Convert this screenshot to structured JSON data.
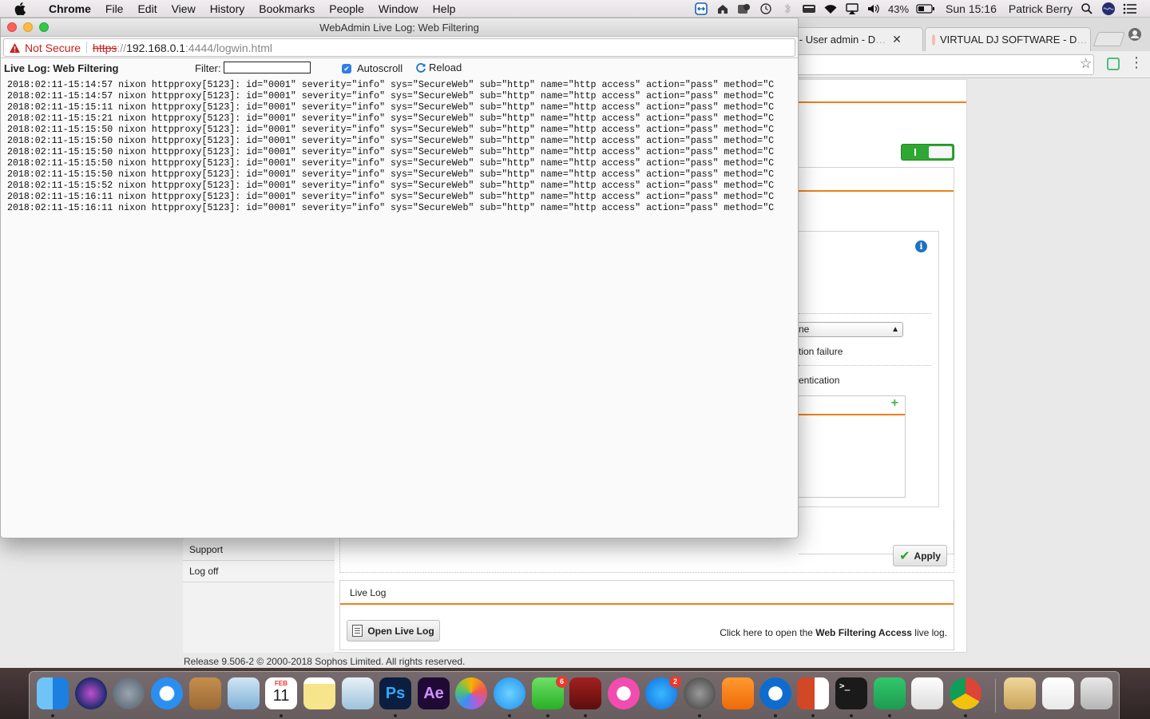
{
  "menubar": {
    "app_name": "Chrome",
    "menus": [
      "File",
      "Edit",
      "View",
      "History",
      "Bookmarks",
      "People",
      "Window",
      "Help"
    ],
    "battery": "43%",
    "clock": "Sun 15:16",
    "user": "Patrick Berry"
  },
  "background_browser": {
    "tabs": [
      {
        "label": "dmin - User admin - D",
        "fade": "…"
      },
      {
        "label": "VIRTUAL DJ SOFTWARE - D",
        "fade": "…"
      }
    ],
    "page": {
      "partial_select_value": "ne",
      "partial_text_1": "tion failure",
      "partial_text_2": "entication",
      "apply_label": "Apply",
      "nav_items": [
        "Support",
        "Log off"
      ],
      "live_log_section_title": "Live Log",
      "open_live_log_label": "Open Live Log",
      "live_log_desc_prefix": "Click here to open the ",
      "live_log_desc_bold": "Web Filtering Access",
      "live_log_desc_suffix": " live log.",
      "footer": "Release 9.506-2  © 2000-2018 Sophos Limited. All rights reserved."
    }
  },
  "popup": {
    "window_title": "WebAdmin Live Log: Web Filtering",
    "not_secure_label": "Not Secure",
    "url_scheme": "https",
    "url_sep": "://",
    "url_host": "192.168.0.1",
    "url_rest": ":4444/logwin.html",
    "log_title": "Live Log: Web Filtering",
    "filter_label": "Filter:",
    "filter_value": "",
    "autoscroll_label": "Autoscroll",
    "autoscroll_checked": true,
    "reload_label": "Reload",
    "log_lines": [
      "2018:02:11-15:14:57 nixon httpproxy[5123]: id=\"0001\" severity=\"info\" sys=\"SecureWeb\" sub=\"http\" name=\"http access\" action=\"pass\" method=\"C",
      "2018:02:11-15:14:57 nixon httpproxy[5123]: id=\"0001\" severity=\"info\" sys=\"SecureWeb\" sub=\"http\" name=\"http access\" action=\"pass\" method=\"C",
      "2018:02:11-15:15:11 nixon httpproxy[5123]: id=\"0001\" severity=\"info\" sys=\"SecureWeb\" sub=\"http\" name=\"http access\" action=\"pass\" method=\"C",
      "2018:02:11-15:15:21 nixon httpproxy[5123]: id=\"0001\" severity=\"info\" sys=\"SecureWeb\" sub=\"http\" name=\"http access\" action=\"pass\" method=\"C",
      "2018:02:11-15:15:50 nixon httpproxy[5123]: id=\"0001\" severity=\"info\" sys=\"SecureWeb\" sub=\"http\" name=\"http access\" action=\"pass\" method=\"C",
      "2018:02:11-15:15:50 nixon httpproxy[5123]: id=\"0001\" severity=\"info\" sys=\"SecureWeb\" sub=\"http\" name=\"http access\" action=\"pass\" method=\"C",
      "2018:02:11-15:15:50 nixon httpproxy[5123]: id=\"0001\" severity=\"info\" sys=\"SecureWeb\" sub=\"http\" name=\"http access\" action=\"pass\" method=\"C",
      "2018:02:11-15:15:50 nixon httpproxy[5123]: id=\"0001\" severity=\"info\" sys=\"SecureWeb\" sub=\"http\" name=\"http access\" action=\"pass\" method=\"C",
      "2018:02:11-15:15:50 nixon httpproxy[5123]: id=\"0001\" severity=\"info\" sys=\"SecureWeb\" sub=\"http\" name=\"http access\" action=\"pass\" method=\"C",
      "2018:02:11-15:15:52 nixon httpproxy[5123]: id=\"0001\" severity=\"info\" sys=\"SecureWeb\" sub=\"http\" name=\"http access\" action=\"pass\" method=\"C",
      "2018:02:11-15:16:11 nixon httpproxy[5123]: id=\"0001\" severity=\"info\" sys=\"SecureWeb\" sub=\"http\" name=\"http access\" action=\"pass\" method=\"C",
      "2018:02:11-15:16:11 nixon httpproxy[5123]: id=\"0001\" severity=\"info\" sys=\"SecureWeb\" sub=\"http\" name=\"http access\" action=\"pass\" method=\"C"
    ]
  },
  "dock": {
    "calendar_month": "FEB",
    "calendar_day": "11",
    "photoshop_label": "Ps",
    "aftereffects_label": "Ae",
    "facetime_badge": "6",
    "appstore_badge": "2"
  },
  "colors": {
    "accent_orange": "#f07f19",
    "toggle_green": "#2ea832",
    "not_secure_red": "#c5221f",
    "info_blue": "#1b72c4"
  }
}
